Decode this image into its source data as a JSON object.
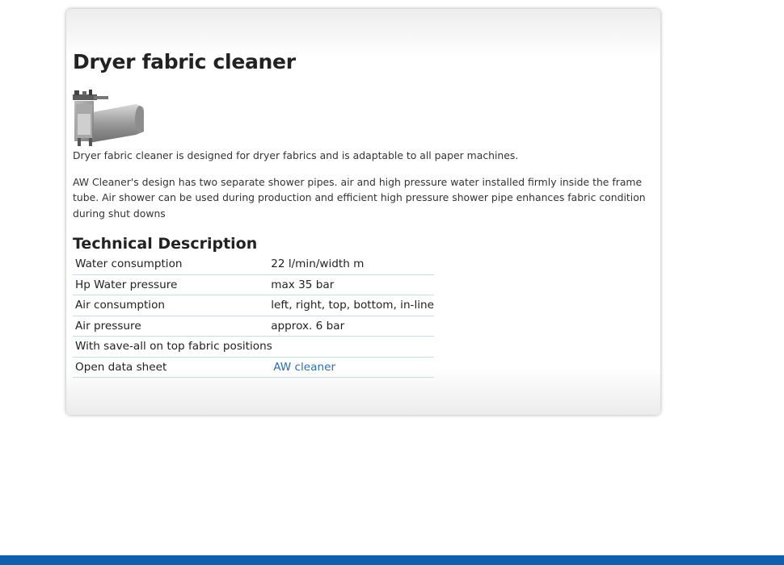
{
  "product": {
    "title": "Dryer fabric cleaner",
    "image_alt": "Dryer fabric cleaner",
    "intro": "Dryer fabric cleaner is designed for dryer fabrics and is adaptable to all paper machines.",
    "design": "AW Cleaner's design has two separate shower pipes. air and high pressure water installed firmly inside the frame tube. Air shower can be used during production and efficient high pressure shower pipe enhances fabric condition during shut downs"
  },
  "technical": {
    "heading": "Technical Description",
    "rows": [
      {
        "key": "Water consumption",
        "value": "22 l/min/width m"
      },
      {
        "key": "Hp Water pressure",
        "value": "max 35 bar"
      },
      {
        "key": "Air consumption",
        "value": "left, right, top, bottom, in-line"
      },
      {
        "key": "Air pressure",
        "value": "approx. 6 bar"
      },
      {
        "key": "With save-all on top fabric positions",
        "value": ""
      },
      {
        "key": "Open data sheet",
        "link": "AW cleaner"
      }
    ]
  },
  "colors": {
    "link": "#2a6db3",
    "footer_bar": "#0e5fad",
    "row_border": "#c9dcea"
  }
}
